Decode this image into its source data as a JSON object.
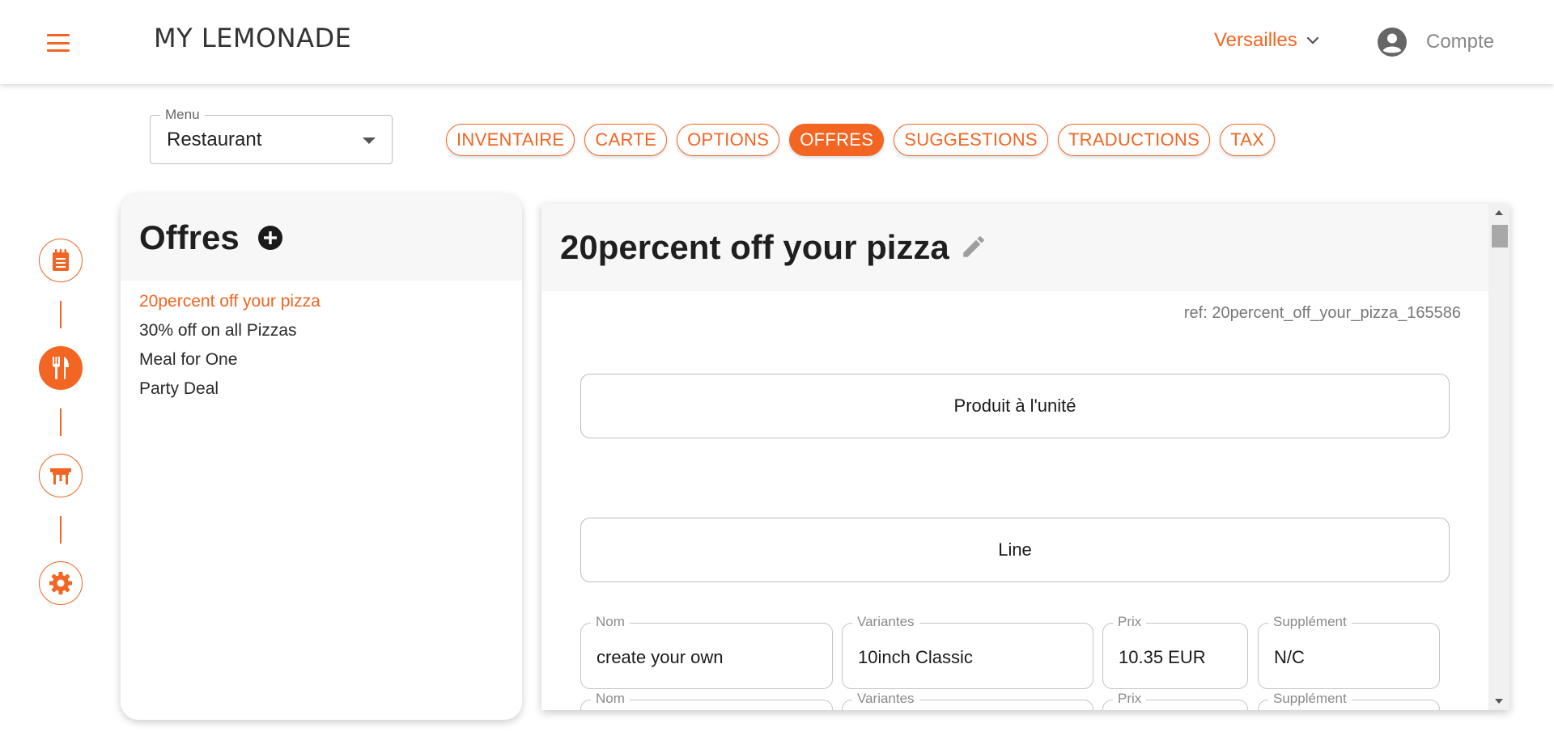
{
  "colors": {
    "accent": "#f26522"
  },
  "header": {
    "logo_text": "MY LEMONADE",
    "city": "Versailles",
    "account_label": "Compte"
  },
  "menu_select": {
    "label": "Menu",
    "value": "Restaurant"
  },
  "tabs": [
    {
      "label": "INVENTAIRE",
      "active": false
    },
    {
      "label": "CARTE",
      "active": false
    },
    {
      "label": "OPTIONS",
      "active": false
    },
    {
      "label": "OFFRES",
      "active": true
    },
    {
      "label": "SUGGESTIONS",
      "active": false
    },
    {
      "label": "TRADUCTIONS",
      "active": false
    },
    {
      "label": "TAX",
      "active": false
    }
  ],
  "sidenav": {
    "items": [
      {
        "icon": "menu-list-icon",
        "active": false
      },
      {
        "icon": "fork-knife-icon",
        "active": true
      },
      {
        "icon": "table-icon",
        "active": false
      },
      {
        "icon": "gear-icon",
        "active": false
      }
    ]
  },
  "offers": {
    "title": "Offres",
    "items": [
      {
        "label": "20percent off your pizza",
        "active": true
      },
      {
        "label": "30% off on all Pizzas",
        "active": false
      },
      {
        "label": "Meal for One",
        "active": false
      },
      {
        "label": "Party Deal",
        "active": false
      }
    ]
  },
  "detail": {
    "title": "20percent off your pizza",
    "ref": "ref: 20percent_off_your_pizza_165586",
    "unit_button_label": "Produit à l'unité",
    "line_button_label": "Line",
    "rows": [
      {
        "nom_label": "Nom",
        "nom": "create your own",
        "variantes_label": "Variantes",
        "variantes": "10inch Classic",
        "prix_label": "Prix",
        "prix": "10.35 EUR",
        "supplement_label": "Supplément",
        "supplement": "N/C"
      },
      {
        "nom_label": "Nom",
        "nom": "",
        "variantes_label": "Variantes",
        "variantes": "",
        "prix_label": "Prix",
        "prix": "",
        "supplement_label": "Supplément",
        "supplement": ""
      }
    ]
  }
}
